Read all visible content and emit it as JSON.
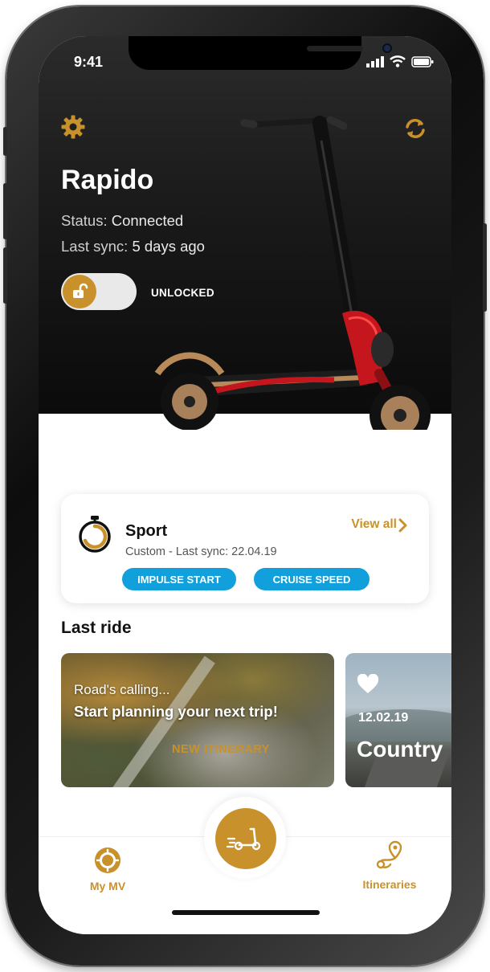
{
  "status_bar": {
    "time": "9:41"
  },
  "header": {
    "title": "Rapido",
    "status_label": "Status:",
    "status_value": "Connected",
    "sync_label": "Last sync:",
    "sync_value": "5 days ago"
  },
  "lock": {
    "state_label": "UNLOCKED"
  },
  "mode_card": {
    "mode": "Sport",
    "detail": "Custom - Last sync: 22.04.19",
    "view_all": "View all",
    "tags": [
      "IMPULSE START",
      "CRUISE SPEED"
    ]
  },
  "last_ride": {
    "heading": "Last ride",
    "cards": [
      {
        "line1": "Road's calling...",
        "line2": "Start planning your next trip!",
        "cta": "NEW ITINERARY"
      },
      {
        "date": "12.02.19",
        "title": "Country"
      }
    ]
  },
  "tabbar": {
    "left_label": "My MV",
    "right_label": "Itineraries"
  },
  "colors": {
    "accent": "#c8912b",
    "pill_blue": "#12a0dc",
    "hero_dark": "#141414"
  },
  "icons": [
    "gear-icon",
    "sync-icon",
    "unlock-icon",
    "stopwatch-icon",
    "chevron-right-icon",
    "heart-icon",
    "scooter-icon",
    "mymv-icon",
    "itineraries-icon"
  ]
}
